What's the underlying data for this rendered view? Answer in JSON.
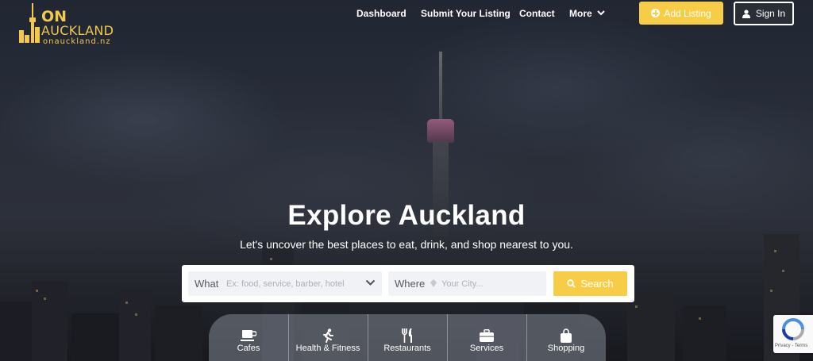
{
  "logo": {
    "line1": "ON",
    "line2": "AUCKLAND",
    "domain": "onauckland.nz"
  },
  "nav": {
    "items": [
      {
        "label": "Dashboard"
      },
      {
        "label": "Submit Your Listing"
      },
      {
        "label": "Contact"
      },
      {
        "label": "More"
      }
    ]
  },
  "header": {
    "add_listing_label": "Add Listing",
    "sign_in_label": "Sign In"
  },
  "hero": {
    "title": "Explore Auckland",
    "subtitle": "Let's uncover the best places to eat, drink, and shop nearest to you."
  },
  "search": {
    "what_label": "What",
    "what_placeholder": "Ex: food, service, barber, hotel",
    "where_label": "Where",
    "where_placeholder": "Your City...",
    "button_label": "Search"
  },
  "categories": [
    {
      "label": "Cafes",
      "icon": "coffee-cup-icon"
    },
    {
      "label": "Health & Fitness",
      "icon": "running-person-icon"
    },
    {
      "label": "Restaurants",
      "icon": "fork-knife-icon"
    },
    {
      "label": "Services",
      "icon": "briefcase-icon"
    },
    {
      "label": "Shopping",
      "icon": "shopping-bag-icon"
    }
  ],
  "recaptcha": {
    "terms": "Privacy - Terms"
  },
  "colors": {
    "accent": "#f7cd48",
    "logo": "#f2c94c"
  }
}
